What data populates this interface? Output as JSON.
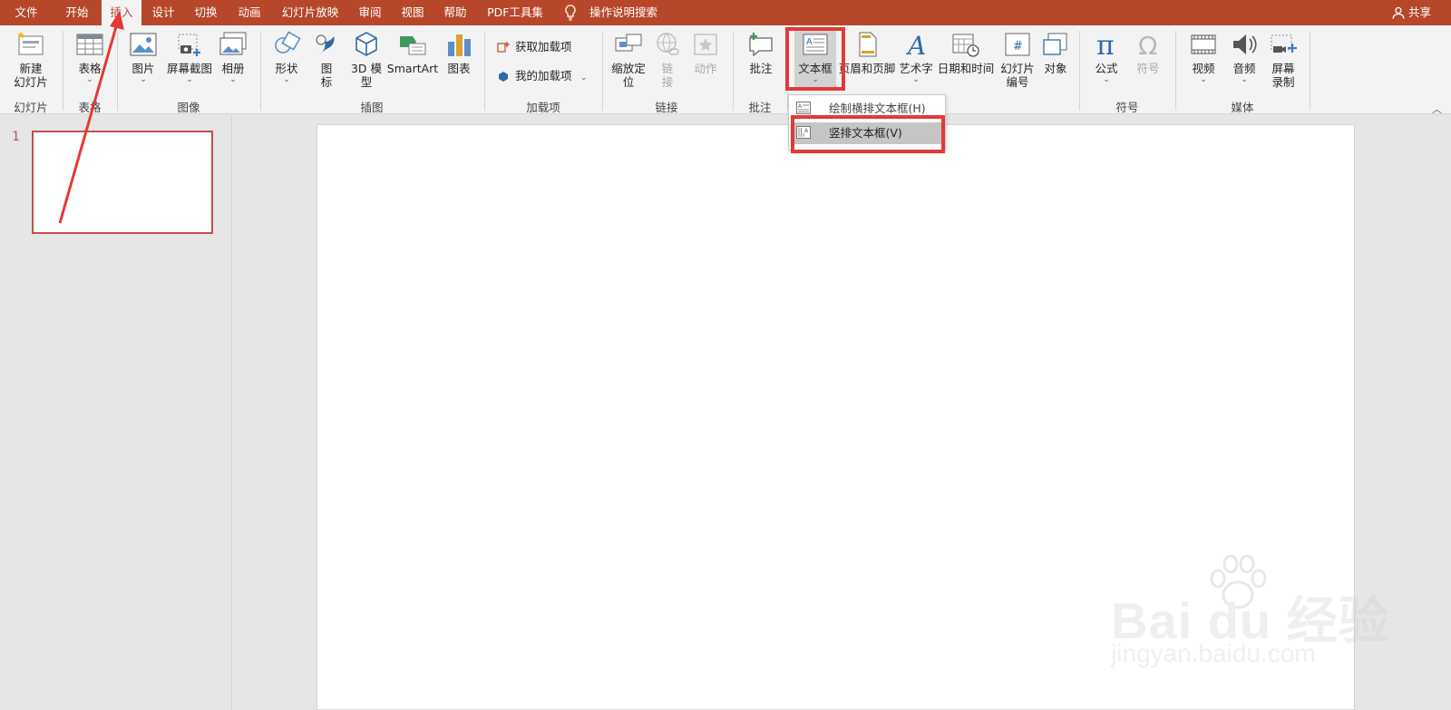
{
  "menu": {
    "tabs": [
      "文件",
      "开始",
      "插入",
      "设计",
      "切换",
      "动画",
      "幻灯片放映",
      "审阅",
      "视图",
      "帮助",
      "PDF工具集"
    ],
    "active_tab": "插入",
    "tell_me": "操作说明搜索",
    "share": "共享"
  },
  "ribbon": {
    "new_slide": {
      "line1": "新建",
      "line2": "幻灯片"
    },
    "table": "表格",
    "picture": "图片",
    "screenshot": "屏幕截图",
    "album": "相册",
    "shapes": "形状",
    "icons": {
      "line1": "图",
      "line2": "标"
    },
    "model3d": {
      "line1": "3D 模",
      "line2": "型"
    },
    "smartart": "SmartArt",
    "chart": "图表",
    "get_addins": "获取加载项",
    "my_addins": "我的加载项",
    "zoom": {
      "line1": "缩放定",
      "line2": "位"
    },
    "link": {
      "line1": "链",
      "line2": "接"
    },
    "action": "动作",
    "comment": "批注",
    "textbox": "文本框",
    "header_footer": "页眉和页脚",
    "wordart": "艺术字",
    "datetime": "日期和时间",
    "slide_number": {
      "line1": "幻灯片",
      "line2": "编号"
    },
    "object": "对象",
    "equation": "公式",
    "symbol": "符号",
    "video": "视频",
    "audio": "音频",
    "screen_recording": {
      "line1": "屏幕",
      "line2": "录制"
    },
    "groups": {
      "slides": "幻灯片",
      "tables": "表格",
      "images": "图像",
      "illustrations": "插图",
      "addins": "加载项",
      "links": "链接",
      "comments": "批注",
      "symbols": "符号",
      "media": "媒体"
    }
  },
  "dropdown": {
    "items": [
      "绘制横排文本框(H)",
      "竖排文本框(V)"
    ],
    "hovered": "竖排文本框(V)"
  },
  "slides_pane": {
    "number": "1"
  },
  "watermark": {
    "brand": "Bai du 经验",
    "url": "jingyan.baidu.com"
  },
  "colors": {
    "accent": "#b7472a",
    "highlight": "#e53935"
  }
}
